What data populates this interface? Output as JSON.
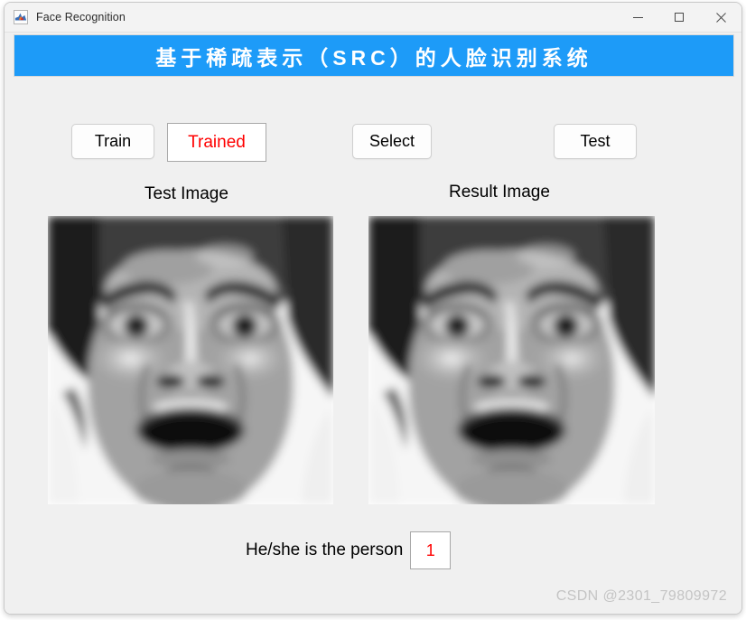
{
  "window": {
    "title": "Face Recognition",
    "icon": "matlab-icon",
    "controls": {
      "minimize": "—",
      "maximize": "□",
      "close": "✕"
    }
  },
  "banner": {
    "text": "基于稀疏表示（SRC）的人脸识别系统",
    "background_color": "#1d9bf8",
    "text_color": "#ffffff"
  },
  "controls": {
    "train_button": "Train",
    "trained_status": "Trained",
    "trained_status_color": "#ff0000",
    "select_button": "Select",
    "test_button": "Test"
  },
  "panels": {
    "test_label": "Test Image",
    "result_label": "Result Image"
  },
  "result": {
    "text": "He/she is the person",
    "value": "1",
    "value_color": "#ff0000"
  },
  "watermark": {
    "text": "CSDN @2301_79809972"
  },
  "colors": {
    "window_background": "#f0f0f0",
    "titlebar_background": "#f3f3f3",
    "accent": "#1d9bf8"
  }
}
